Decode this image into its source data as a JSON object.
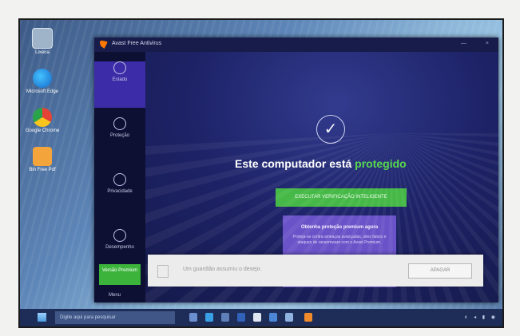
{
  "desktop": {
    "icons": [
      {
        "name": "recycle-bin",
        "label": "Lixeira"
      },
      {
        "name": "edge",
        "label": "Microsoft Edge"
      },
      {
        "name": "chrome",
        "label": "Google Chrome"
      },
      {
        "name": "folder",
        "label": "Bin Free Pdf"
      }
    ]
  },
  "avast": {
    "title": "Avast Free Antivirus",
    "controls": [
      "—",
      "×"
    ],
    "nav": [
      {
        "label": "Estado",
        "icon": "status-icon",
        "active": true
      },
      {
        "label": "Proteção",
        "icon": "lock-icon",
        "active": false
      },
      {
        "label": "Privacidade",
        "icon": "fingerprint-icon",
        "active": false
      },
      {
        "label": "Desempenho",
        "icon": "gauge-icon",
        "active": false
      }
    ],
    "side_green": "Versão Premium",
    "menu_label": "Menu",
    "status_title": "Este computador está",
    "status_ok": "protegido",
    "scan_button": "EXECUTAR VERIFICAÇÃO INTELIGENTE",
    "promo_title": "Obtenha proteção premium agora",
    "promo_body": "Proteja-se contra ameaças avançadas, sites falsos e ataques de ransomware com o Avast Premium."
  },
  "notification": {
    "message": "Um guardião assumiu o desejo.",
    "button": "APAGAR"
  },
  "taskbar": {
    "search_placeholder": "Digite aqui para pesquisar",
    "tray": "∧ ◂ ▮ ◉"
  },
  "colors": {
    "avast_bg": "#1d2266",
    "sidebar_active": "#3d2ca7",
    "ok_green": "#54d84a",
    "button_green": "#46b847",
    "promo_purple": "#6a53c8"
  }
}
